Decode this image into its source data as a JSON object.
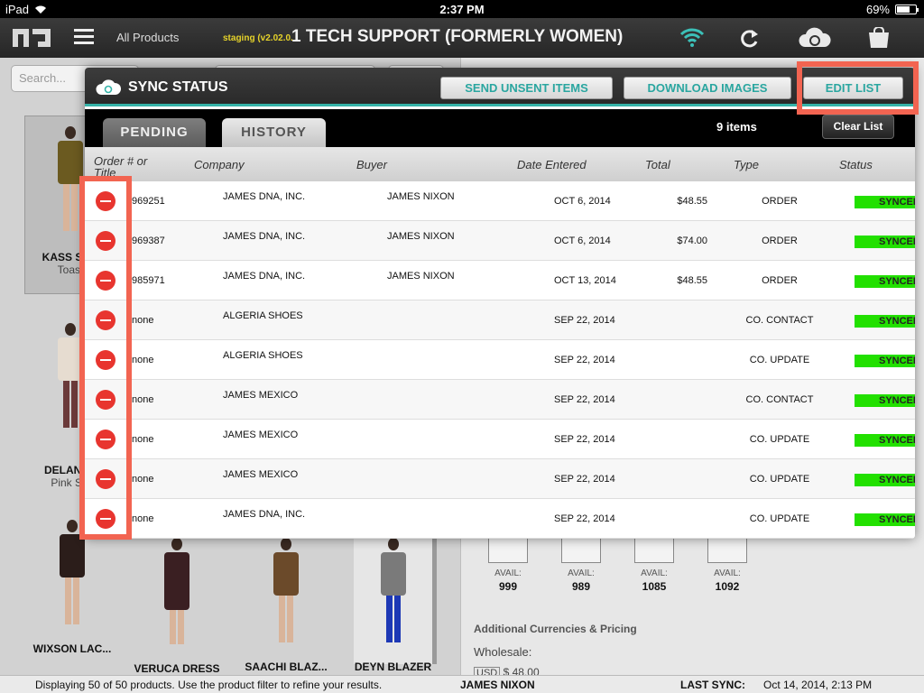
{
  "statusbar": {
    "device": "iPad",
    "time": "2:37 PM",
    "battery": "69%",
    "battery_level": 0.69
  },
  "toolbar": {
    "all_products": "All Products",
    "staging": "staging (v2.02.0.",
    "title": "1 TECH SUPPORT (FORMERLY WOMEN)",
    "icons": [
      "logo-icon",
      "menu-icon",
      "wifi-icon",
      "refresh-icon",
      "cloud-sync-icon",
      "shopping-bag-icon"
    ]
  },
  "background": {
    "search_placeholder": "Search...",
    "products": [
      {
        "name": "KASS SHO",
        "color": "Toast"
      },
      {
        "name": "DELANCE",
        "color": "Pink Sw"
      },
      {
        "name": "WIXSON LAC...",
        "color": ""
      },
      {
        "name": "VERUCA DRESS",
        "color": ""
      },
      {
        "name": "SAACHI BLAZ...",
        "color": ""
      },
      {
        "name": "DEYN BLAZER",
        "color": ""
      }
    ],
    "avail_label": "AVAIL:",
    "avail": [
      "999",
      "989",
      "1085",
      "1092"
    ],
    "additional_pricing": "Additional Currencies & Pricing",
    "wholesale": "Wholesale:",
    "currency": "USD",
    "price": "$ 48.00"
  },
  "modal": {
    "title": "SYNC STATUS",
    "buttons": {
      "send_unsent": "SEND UNSENT ITEMS",
      "download_images": "DOWNLOAD IMAGES",
      "edit_list": "EDIT LIST"
    },
    "tabs": {
      "pending": "PENDING",
      "history": "HISTORY"
    },
    "items_count": "9 items",
    "clear_list": "Clear List",
    "columns": {
      "order": "Order #  or",
      "order2": "Title",
      "company": "Company",
      "buyer": "Buyer",
      "date": "Date Entered",
      "total": "Total",
      "type": "Type",
      "status": "Status"
    },
    "rows": [
      {
        "order": "969251",
        "company": "JAMES DNA, INC.",
        "buyer": "JAMES NIXON",
        "date": "OCT 6, 2014",
        "total": "$48.55",
        "type": "ORDER",
        "status": "SYNCED"
      },
      {
        "order": "969387",
        "company": "JAMES DNA, INC.",
        "buyer": "JAMES NIXON",
        "date": "OCT 6, 2014",
        "total": "$74.00",
        "type": "ORDER",
        "status": "SYNCED"
      },
      {
        "order": "985971",
        "company": "JAMES DNA, INC.",
        "buyer": "JAMES NIXON",
        "date": "OCT 13, 2014",
        "total": "$48.55",
        "type": "ORDER",
        "status": "SYNCED"
      },
      {
        "order": "none",
        "company": "ALGERIA SHOES",
        "buyer": "",
        "date": "SEP 22, 2014",
        "total": "",
        "type": "CO. CONTACT",
        "status": "SYNCED"
      },
      {
        "order": "none",
        "company": "ALGERIA SHOES",
        "buyer": "",
        "date": "SEP 22, 2014",
        "total": "",
        "type": "CO. UPDATE",
        "status": "SYNCED"
      },
      {
        "order": "none",
        "company": "JAMES MEXICO",
        "buyer": "",
        "date": "SEP 22, 2014",
        "total": "",
        "type": "CO. CONTACT",
        "status": "SYNCED"
      },
      {
        "order": "none",
        "company": "JAMES MEXICO",
        "buyer": "",
        "date": "SEP 22, 2014",
        "total": "",
        "type": "CO. UPDATE",
        "status": "SYNCED"
      },
      {
        "order": "none",
        "company": "JAMES MEXICO",
        "buyer": "",
        "date": "SEP 22, 2014",
        "total": "",
        "type": "CO. UPDATE",
        "status": "SYNCED"
      },
      {
        "order": "none",
        "company": "JAMES DNA, INC.",
        "buyer": "",
        "date": "SEP 22, 2014",
        "total": "",
        "type": "CO. UPDATE",
        "status": "SYNCED"
      }
    ]
  },
  "bottombar": {
    "displaying": "Displaying 50 of 50 products.  Use the product filter to refine your results.",
    "buyer": "JAMES NIXON",
    "last_sync_label": "LAST SYNC:",
    "last_sync_value": "Oct 14, 2014, 2:13 PM"
  },
  "colors": {
    "accent": "#35b3a8",
    "button_text": "#2aa6a0",
    "delete": "#e8352f",
    "synced": "#22e000",
    "highlight": "#f26451"
  }
}
